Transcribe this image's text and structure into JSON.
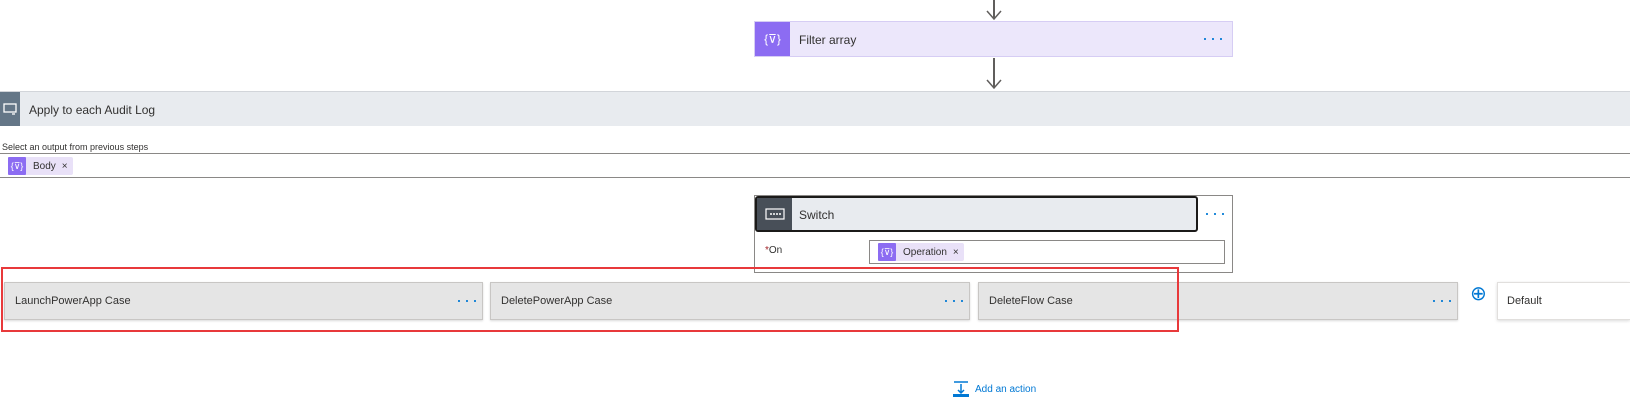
{
  "filter_array": {
    "title": "Filter array",
    "more": "···",
    "icon": "{⊽}"
  },
  "apply_each": {
    "title": "Apply to each Audit Log",
    "output_label": "Select an output from previous steps",
    "token": {
      "label": "Body",
      "icon": "{⊽}",
      "remove": "×"
    }
  },
  "switch": {
    "title": "Switch",
    "more": "···",
    "on_required": "*",
    "on_label": "On",
    "token": {
      "label": "Operation",
      "icon": "{⊽}",
      "remove": "×"
    }
  },
  "cases": [
    {
      "title": "LaunchPowerApp Case",
      "more": "···"
    },
    {
      "title": "DeletePowerApp Case",
      "more": "···"
    },
    {
      "title": "DeleteFlow Case",
      "more": "···"
    }
  ],
  "add_case_icon": "⊕",
  "default_case": {
    "title": "Default"
  },
  "add_action": {
    "label": "Add an action"
  },
  "colors": {
    "accent": "#0078d4",
    "filter_bg": "#ece7fb",
    "filter_icon": "#8c6cf2",
    "apply_bg": "#e8ebef",
    "highlight": "#e8393b"
  }
}
